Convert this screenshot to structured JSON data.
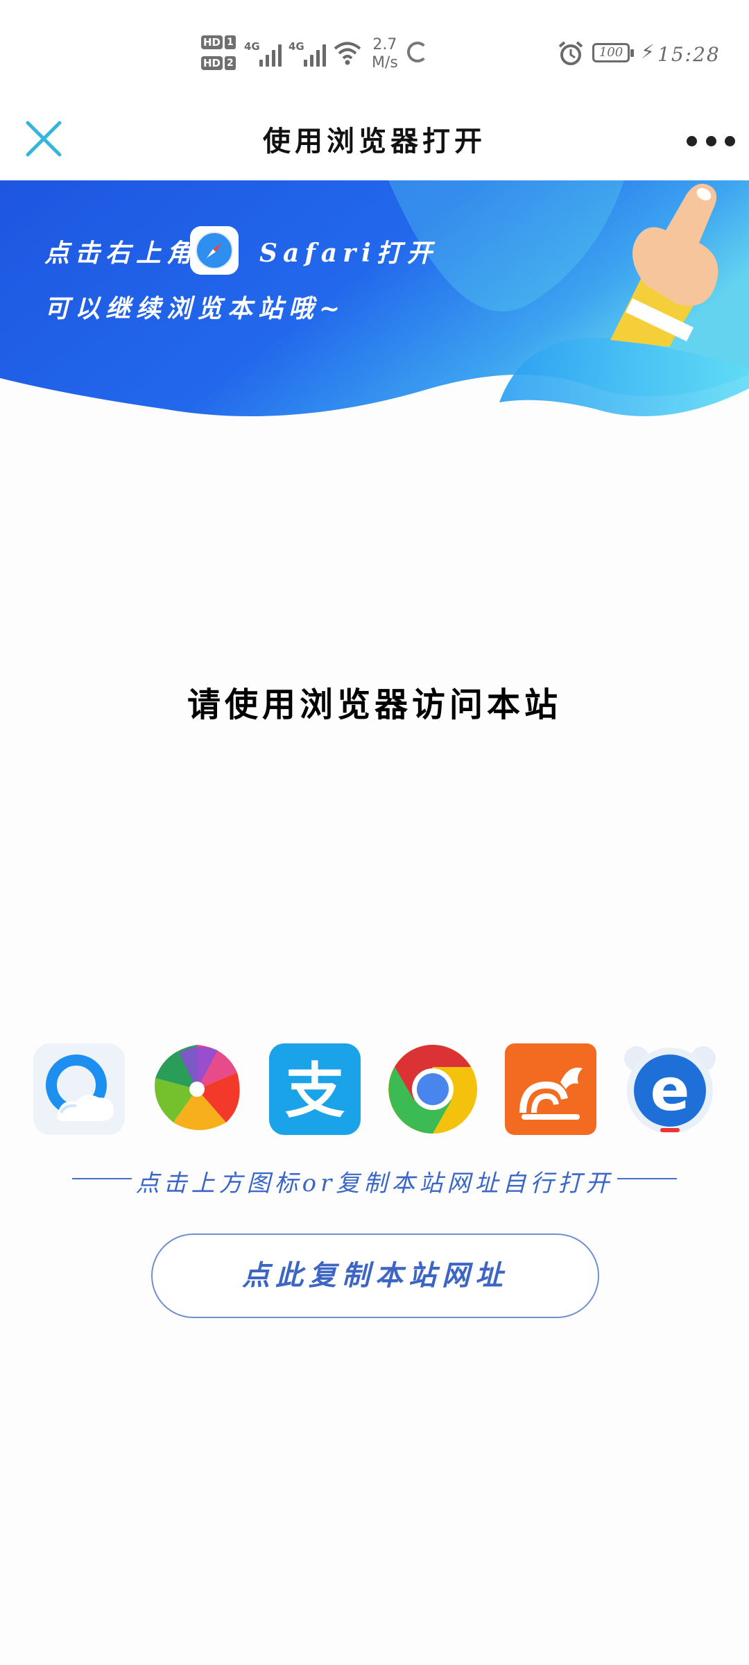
{
  "status_bar": {
    "sim1_hd": "HD",
    "sim1_num": "1",
    "sim2_hd": "HD",
    "sim2_num": "2",
    "net1": "4G",
    "net2": "4G",
    "speed_value": "2.7",
    "speed_unit": "M/s",
    "battery": "100",
    "time": "15:28"
  },
  "nav": {
    "title": "使用浏览器打开"
  },
  "banner": {
    "line1_prefix": "点击右上角",
    "line1_suffix": "Safari打开",
    "line2": "可以继续浏览本站哦~",
    "colors": {
      "blue_dark": "#1a4fd6",
      "blue_light": "#5fd0f3"
    }
  },
  "main": {
    "prompt": "请使用浏览器访问本站"
  },
  "browsers": [
    {
      "name": "QQ浏览器",
      "icon": "qq-browser-icon"
    },
    {
      "name": "360浏览器",
      "icon": "pinwheel-browser-icon"
    },
    {
      "name": "支付宝",
      "icon": "alipay-icon",
      "glyph": "支"
    },
    {
      "name": "Chrome",
      "icon": "chrome-icon"
    },
    {
      "name": "UC浏览器",
      "icon": "uc-browser-icon"
    },
    {
      "name": "IE",
      "icon": "ie-icon",
      "glyph": "e"
    }
  ],
  "divider_text": "点击上方图标or复制本站网址自行打开",
  "copy_button": "点此复制本站网址",
  "accent_color": "#3d66c4"
}
